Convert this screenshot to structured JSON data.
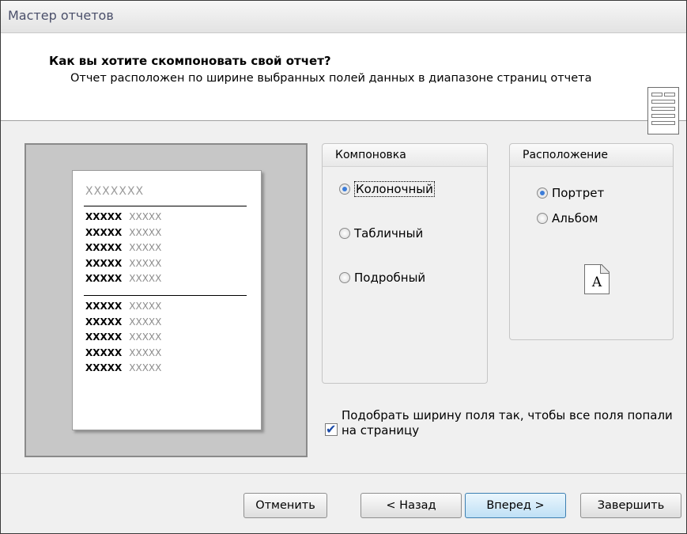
{
  "window": {
    "title": "Мастер отчетов"
  },
  "header": {
    "title": "Как вы хотите скомпоновать свой отчет?",
    "description": "Отчет расположен по ширине выбранных полей данных в диапазоне страниц отчета",
    "icon": "report-layout-icon"
  },
  "preview": {
    "title": "XXXXXXX",
    "row_key": "XXXXX",
    "row_value": "XXXXX"
  },
  "layout_group": {
    "title": "Компоновка",
    "options": [
      {
        "label": "Колоночный",
        "selected": true
      },
      {
        "label": "Табличный",
        "selected": false
      },
      {
        "label": "Подробный",
        "selected": false
      }
    ]
  },
  "orientation_group": {
    "title": "Расположение",
    "options": [
      {
        "label": "Портрет",
        "selected": true
      },
      {
        "label": "Альбом",
        "selected": false
      }
    ],
    "page_icon_letter": "A"
  },
  "fit_checkbox": {
    "checked": true,
    "label": "Подобрать ширину поля так, чтобы все поля попали на страницу"
  },
  "buttons": {
    "cancel": "Отменить",
    "back": "< Назад",
    "next": "Вперед >",
    "finish": "Завершить"
  },
  "colors": {
    "accent": "#3d7dd8",
    "preview_bg": "#c7c7c7",
    "check": "#1a4aa8"
  }
}
